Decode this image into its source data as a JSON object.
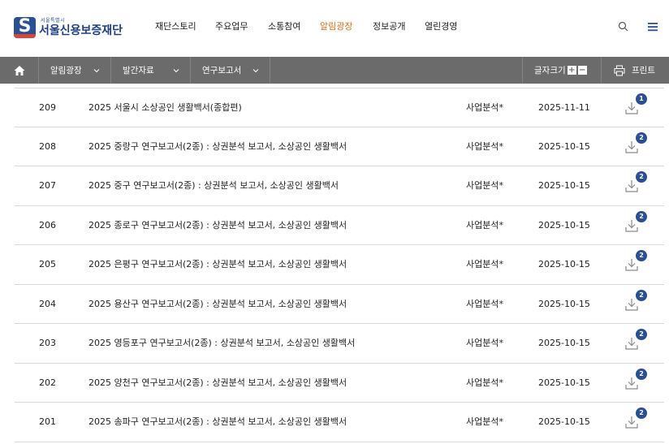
{
  "header": {
    "logo_sub": "서울특별시",
    "logo_main": "서울신용보증재단",
    "logo_mark": "S",
    "nav": [
      {
        "label": "재단스토리",
        "active": false
      },
      {
        "label": "주요업무",
        "active": false
      },
      {
        "label": "소통참여",
        "active": false
      },
      {
        "label": "알림광장",
        "active": true
      },
      {
        "label": "정보공개",
        "active": false
      },
      {
        "label": "열린경영",
        "active": false
      }
    ],
    "icons": [
      "search-icon",
      "hamburger-menu-icon"
    ]
  },
  "subnav": {
    "home_icon": "home-icon",
    "crumbs": [
      {
        "label": "알림광장"
      },
      {
        "label": "발간자료"
      },
      {
        "label": "연구보고서"
      }
    ],
    "font_size_label": "글자크기",
    "font_plus": "+",
    "font_minus": "−",
    "print_label": "프린트"
  },
  "colors": {
    "brand": "#2a4f93",
    "accent_active": "#c9721d",
    "subnav_bg": "#6b6b6b",
    "badge_bg": "#2a4f93"
  },
  "rows": [
    {
      "num": "209",
      "title": "2025 서울시 소상공인 생활백서(종합편)",
      "category": "사업분석*",
      "date": "2025-11-11",
      "files": "1"
    },
    {
      "num": "208",
      "title": "2025 중랑구 연구보고서(2종) : 상권분석 보고서, 소상공인 생활백서",
      "category": "사업분석*",
      "date": "2025-10-15",
      "files": "2"
    },
    {
      "num": "207",
      "title": "2025 중구 연구보고서(2종) : 상권분석 보고서, 소상공인 생활백서",
      "category": "사업분석*",
      "date": "2025-10-15",
      "files": "2"
    },
    {
      "num": "206",
      "title": "2025 종로구 연구보고서(2종) : 상권분석 보고서, 소상공인 생활백서",
      "category": "사업분석*",
      "date": "2025-10-15",
      "files": "2"
    },
    {
      "num": "205",
      "title": "2025 은평구 연구보고서(2종) : 상권분석 보고서, 소상공인 생활백서",
      "category": "사업분석*",
      "date": "2025-10-15",
      "files": "2"
    },
    {
      "num": "204",
      "title": "2025 용산구 연구보고서(2종) : 상권분석 보고서, 소상공인 생활백서",
      "category": "사업분석*",
      "date": "2025-10-15",
      "files": "2"
    },
    {
      "num": "203",
      "title": "2025 영등포구 연구보고서(2종) : 상권분석 보고서, 소상공인 생활백서",
      "category": "사업분석*",
      "date": "2025-10-15",
      "files": "2"
    },
    {
      "num": "202",
      "title": "2025 양천구 연구보고서(2종) : 상권분석 보고서, 소상공인 생활백서",
      "category": "사업분석*",
      "date": "2025-10-15",
      "files": "2"
    },
    {
      "num": "201",
      "title": "2025 송파구 연구보고서(2종) : 상권분석 보고서, 소상공인 생활백서",
      "category": "사업분석*",
      "date": "2025-10-15",
      "files": "2"
    }
  ]
}
